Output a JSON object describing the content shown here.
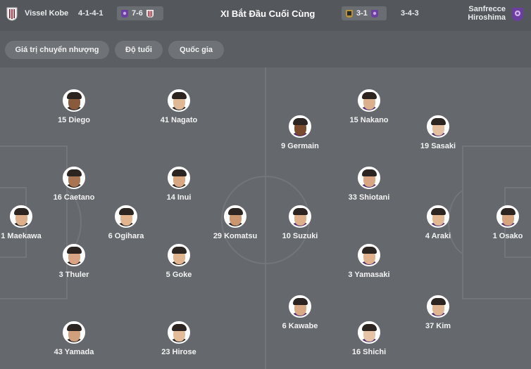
{
  "header": {
    "home_team": "Vissel Kobe",
    "home_formation": "4-1-4-1",
    "home_recent_score": "7-6",
    "title": "XI Bắt Đầu Cuối Cùng",
    "away_recent_score": "3-1",
    "away_formation": "3-4-3",
    "away_team_line1": "Sanfrecce",
    "away_team_line2": "Hiroshima"
  },
  "tabs": [
    "Giá trị chuyển nhượng",
    "Độ tuổi",
    "Quốc gia"
  ],
  "home_players": [
    {
      "label": "15 Diego",
      "skin": "#8a5a3c",
      "shirt": "#1b1b1b"
    },
    {
      "label": "41 Nagato",
      "skin": "#e0b896",
      "shirt": "#1b1b1b"
    },
    {
      "label": "16 Caetano",
      "skin": "#a87451",
      "shirt": "#1b1b1b"
    },
    {
      "label": "14 Inui",
      "skin": "#d9a882",
      "shirt": "#1b1b1b"
    },
    {
      "label": "1 Maekawa",
      "skin": "#dcae89",
      "shirt": "#1b1b1b"
    },
    {
      "label": "6 Ogihara",
      "skin": "#e2b58f",
      "shirt": "#1b1b1b"
    },
    {
      "label": "29 Komatsu",
      "skin": "#c99670",
      "shirt": "#1b1b1b"
    },
    {
      "label": "3 Thuler",
      "skin": "#d8a483",
      "shirt": "#1b1b1b"
    },
    {
      "label": "5 Goke",
      "skin": "#e0b48e",
      "shirt": "#1b1b1b"
    },
    {
      "label": "43 Yamada",
      "skin": "#d0a07d",
      "shirt": "#1b1b1b"
    },
    {
      "label": "23 Hirose",
      "skin": "#e3bb98",
      "shirt": "#1b1b1b"
    }
  ],
  "away_players": [
    {
      "label": "15 Nakano",
      "skin": "#dcb08c",
      "shirt": "#4a2c6e"
    },
    {
      "label": "9 Germain",
      "skin": "#7a4a2c",
      "shirt": "#4a2c6e"
    },
    {
      "label": "19 Sasaki",
      "skin": "#e4c0a0",
      "shirt": "#4a2c6e"
    },
    {
      "label": "33 Shiotani",
      "skin": "#d8a682",
      "shirt": "#4a2c6e"
    },
    {
      "label": "10 Suzuki",
      "skin": "#dcae89",
      "shirt": "#4a2c6e"
    },
    {
      "label": "4 Araki",
      "skin": "#e2b893",
      "shirt": "#4a2c6e"
    },
    {
      "label": "1 Osako",
      "skin": "#d6a47f",
      "shirt": "#4a2c6e"
    },
    {
      "label": "3 Yamasaki",
      "skin": "#dfb28d",
      "shirt": "#4a2c6e"
    },
    {
      "label": "6 Kawabe",
      "skin": "#d9a985",
      "shirt": "#4a2c6e"
    },
    {
      "label": "37 Kim",
      "skin": "#e0b591",
      "shirt": "#4a2c6e"
    },
    {
      "label": "16 Shichi",
      "skin": "#e6c3a4",
      "shirt": "#4a2c6e"
    }
  ],
  "colors": {
    "vissel": "#8b1a2b",
    "sanfrecce": "#6b3fa0",
    "accent_gold": "#b8923a"
  }
}
